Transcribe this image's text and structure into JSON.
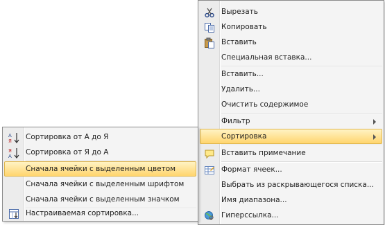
{
  "context_menu": {
    "items": [
      {
        "label": "Вырезать",
        "icon": "scissors-icon"
      },
      {
        "label": "Копировать",
        "icon": "copy-icon"
      },
      {
        "label": "Вставить",
        "icon": "paste-icon"
      },
      {
        "label": "Специальная вставка...",
        "icon": ""
      },
      {
        "label": "Вставить...",
        "icon": ""
      },
      {
        "label": "Удалить...",
        "icon": ""
      },
      {
        "label": "Очистить содержимое",
        "icon": ""
      },
      {
        "label": "Фильтр",
        "icon": "",
        "submenu": true
      },
      {
        "label": "Сортировка",
        "icon": "",
        "submenu": true,
        "highlighted": true
      },
      {
        "label": "Вставить примечание",
        "icon": "insert-comment-icon"
      },
      {
        "label": "Формат ячеек...",
        "icon": "format-cells-icon"
      },
      {
        "label": "Выбрать из раскрывающегося списка...",
        "icon": ""
      },
      {
        "label": "Имя диапазона...",
        "icon": ""
      },
      {
        "label": "Гиперссылка...",
        "icon": "hyperlink-icon"
      }
    ]
  },
  "sort_submenu": {
    "items": [
      {
        "label": "Сортировка от А до Я",
        "icon": "sort-ascending-icon"
      },
      {
        "label": "Сортировка от Я до А",
        "icon": "sort-descending-icon"
      },
      {
        "label": "Сначала ячейки с выделенным цветом",
        "icon": "",
        "highlighted": true
      },
      {
        "label": "Сначала ячейки с выделенным шрифтом",
        "icon": ""
      },
      {
        "label": "Сначала ячейки с выделенным значком",
        "icon": ""
      },
      {
        "label": "Настраиваемая сортировка...",
        "icon": "custom-sort-icon"
      }
    ]
  },
  "colors": {
    "menu_background": "#f4f4f4",
    "highlight_top": "#fff3c4",
    "highlight_bottom": "#ffd56e",
    "highlight_border": "#e0b64d"
  }
}
